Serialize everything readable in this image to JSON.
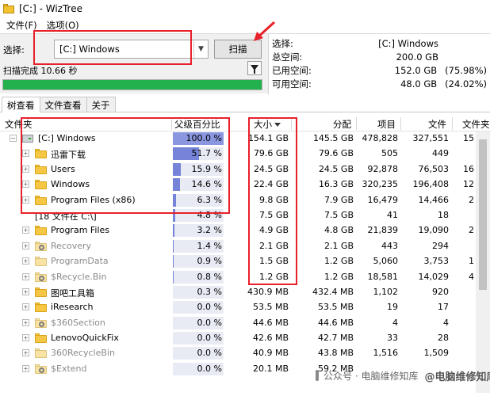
{
  "window": {
    "title": "[C:]  - WizTree"
  },
  "menu": {
    "items": [
      "文件(F)",
      "选项(O)"
    ]
  },
  "toolbar": {
    "select_label": "选择:",
    "drive_value": "[C:] Windows",
    "scan_label": "扫描",
    "status": "扫描完成 10.66 秒",
    "progress_percent": 100
  },
  "drive_info": {
    "rows": [
      {
        "label": "选择:",
        "value": "[C:]  Windows",
        "extra": ""
      },
      {
        "label": "总空间:",
        "value": "200.0 GB",
        "extra": ""
      },
      {
        "label": "已用空间:",
        "value": "152.0 GB",
        "extra": "(75.98%)"
      },
      {
        "label": "可用空间:",
        "value": "48.0 GB",
        "extra": "(24.02%)"
      }
    ]
  },
  "tabs": [
    "树查看",
    "文件查看",
    "关于"
  ],
  "columns": {
    "folder": "文件夹",
    "parent_pct": "父级百分比",
    "size": "大小",
    "allocated": "分配",
    "items": "项目",
    "files": "文件",
    "files2": "文件夹"
  },
  "rows": [
    {
      "name": "[C:] Windows",
      "pct": "100.0 %",
      "pct_value": 100.0,
      "size": "154.1 GB",
      "alloc": "145.5 GB",
      "items": "478,828",
      "files": "327,551",
      "extra": "15",
      "icon": "drive",
      "tree": "−",
      "grey": false
    },
    {
      "name": "迅雷下载",
      "pct": "51.7 %",
      "pct_value": 51.7,
      "size": "79.6 GB",
      "alloc": "79.6 GB",
      "items": "505",
      "files": "449",
      "extra": "",
      "icon": "folder",
      "tree": "+",
      "grey": false
    },
    {
      "name": "Users",
      "pct": "15.9 %",
      "pct_value": 15.9,
      "size": "24.5 GB",
      "alloc": "24.5 GB",
      "items": "92,878",
      "files": "76,503",
      "extra": "16",
      "icon": "folder",
      "tree": "+",
      "grey": false
    },
    {
      "name": "Windows",
      "pct": "14.6 %",
      "pct_value": 14.6,
      "size": "22.4 GB",
      "alloc": "16.3 GB",
      "items": "320,235",
      "files": "196,408",
      "extra": "12",
      "icon": "folder",
      "tree": "+",
      "grey": false
    },
    {
      "name": "Program Files (x86)",
      "pct": "6.3 %",
      "pct_value": 6.3,
      "size": "9.8 GB",
      "alloc": "7.9 GB",
      "items": "16,479",
      "files": "14,466",
      "extra": "2",
      "icon": "folder",
      "tree": "+",
      "grey": false
    },
    {
      "name": "[18 文件在 C:\\]",
      "pct": "4.8 %",
      "pct_value": 4.8,
      "size": "7.5 GB",
      "alloc": "7.5 GB",
      "items": "41",
      "files": "18",
      "extra": "",
      "icon": "none",
      "tree": "",
      "grey": false
    },
    {
      "name": "Program Files",
      "pct": "3.2 %",
      "pct_value": 3.2,
      "size": "4.9 GB",
      "alloc": "4.8 GB",
      "items": "21,839",
      "files": "19,090",
      "extra": "2",
      "icon": "folder",
      "tree": "+",
      "grey": false
    },
    {
      "name": "Recovery",
      "pct": "1.4 %",
      "pct_value": 1.4,
      "size": "2.1 GB",
      "alloc": "2.1 GB",
      "items": "443",
      "files": "294",
      "extra": "",
      "icon": "sys",
      "tree": "+",
      "grey": true
    },
    {
      "name": "ProgramData",
      "pct": "0.9 %",
      "pct_value": 0.9,
      "size": "1.5 GB",
      "alloc": "1.2 GB",
      "items": "5,060",
      "files": "3,753",
      "extra": "1",
      "icon": "sysplain",
      "tree": "+",
      "grey": true
    },
    {
      "name": "$Recycle.Bin",
      "pct": "0.8 %",
      "pct_value": 0.8,
      "size": "1.2 GB",
      "alloc": "1.2 GB",
      "items": "18,581",
      "files": "14,029",
      "extra": "4",
      "icon": "sys",
      "tree": "+",
      "grey": true
    },
    {
      "name": "图吧工具箱",
      "pct": "0.3 %",
      "pct_value": 0.3,
      "size": "430.9 MB",
      "alloc": "432.4 MB",
      "items": "1,102",
      "files": "920",
      "extra": "",
      "icon": "folder",
      "tree": "+",
      "grey": false
    },
    {
      "name": "iResearch",
      "pct": "0.0 %",
      "pct_value": 0.0,
      "size": "53.5 MB",
      "alloc": "53.5 MB",
      "items": "19",
      "files": "17",
      "extra": "",
      "icon": "folder",
      "tree": "+",
      "grey": false
    },
    {
      "name": "$360Section",
      "pct": "0.0 %",
      "pct_value": 0.0,
      "size": "44.6 MB",
      "alloc": "44.6 MB",
      "items": "4",
      "files": "4",
      "extra": "",
      "icon": "sys",
      "tree": "+",
      "grey": true
    },
    {
      "name": "LenovoQuickFix",
      "pct": "0.0 %",
      "pct_value": 0.0,
      "size": "42.6 MB",
      "alloc": "42.7 MB",
      "items": "33",
      "files": "28",
      "extra": "",
      "icon": "folder",
      "tree": "+",
      "grey": false
    },
    {
      "name": "360RecycleBin",
      "pct": "0.0 %",
      "pct_value": 0.0,
      "size": "40.9 MB",
      "alloc": "43.8 MB",
      "items": "1,516",
      "files": "1,509",
      "extra": "",
      "icon": "sysplain",
      "tree": "+",
      "grey": true
    },
    {
      "name": "$Extend",
      "pct": "0.0 %",
      "pct_value": 0.0,
      "size": "20.1 MB",
      "alloc": "59.2 MB",
      "items": "",
      "files": "",
      "extra": "",
      "icon": "sys",
      "tree": "+",
      "grey": true
    }
  ],
  "watermark": {
    "text": "公众号 · 电脑维修知库",
    "text2": "@电脑维修知库"
  }
}
